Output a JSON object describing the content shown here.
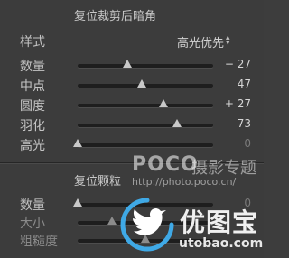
{
  "vignette": {
    "title": "复位裁剪后暗角",
    "style_label": "样式",
    "style_value": "高光优先",
    "sliders": [
      {
        "label": "数量",
        "value": "− 27",
        "level": -27,
        "min": -100,
        "max": 100
      },
      {
        "label": "中点",
        "value": "47",
        "level": 47,
        "min": 0,
        "max": 100
      },
      {
        "label": "圆度",
        "value": "+ 27",
        "level": 27,
        "min": -100,
        "max": 100
      },
      {
        "label": "羽化",
        "value": "73",
        "level": 73,
        "min": 0,
        "max": 100
      },
      {
        "label": "高光",
        "value": "0",
        "level": 0,
        "min": 0,
        "max": 100
      }
    ]
  },
  "grain": {
    "title": "复位颗粒",
    "sliders": [
      {
        "label": "数量",
        "value": "0",
        "level": 0,
        "min": 0,
        "max": 100
      },
      {
        "label": "大小",
        "value": "",
        "level": 25,
        "min": 0,
        "max": 100
      },
      {
        "label": "粗糙度",
        "value": "",
        "level": 50,
        "min": 0,
        "max": 100
      }
    ]
  },
  "watermark": {
    "poco": "POCO",
    "poco_zh": "摄影专题",
    "url": "http://photo.poco.cn/",
    "brand": "优图宝",
    "domain": "utobao.com"
  }
}
